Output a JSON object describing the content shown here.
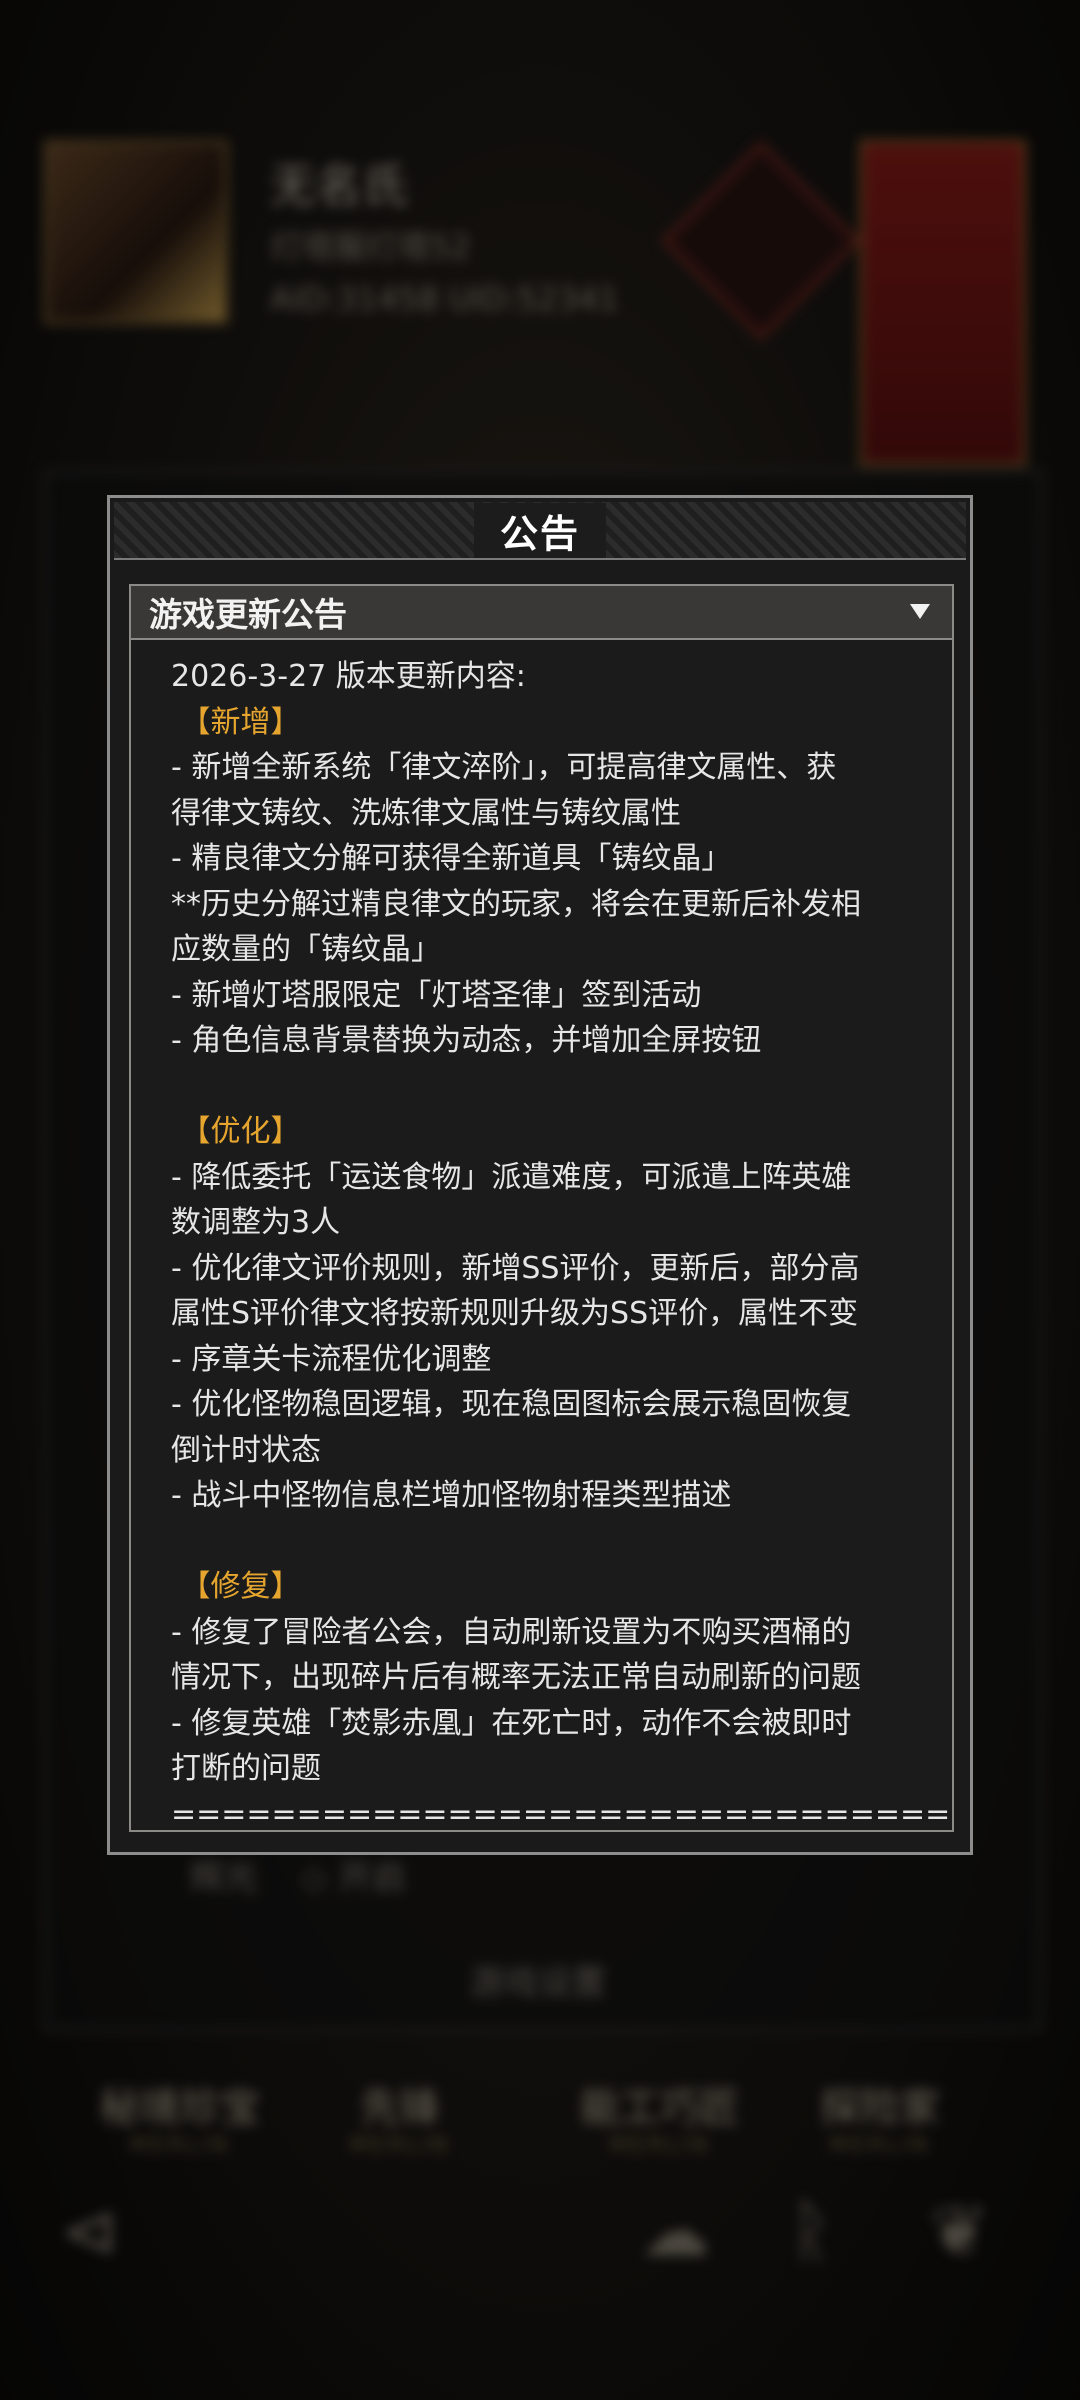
{
  "background": {
    "profile_name": "无名氏",
    "profile_sub": "灯塔服灯塔52",
    "profile_id": "AID:31458 UID:52341",
    "row_label": "辉光",
    "row_toggle": "开启",
    "settings_label": "游戏设置",
    "tabs": [
      {
        "label": "秘境珍宝",
        "sub": "MERLIN"
      },
      {
        "label": "先锋",
        "sub": "MERLIN"
      },
      {
        "label": "能工巧匠",
        "sub": "MERLIN"
      },
      {
        "label": "探险家",
        "sub": "MERLIN"
      }
    ]
  },
  "modal": {
    "title": "公告",
    "select_label": "游戏更新公告",
    "lines": [
      {
        "text": "2026-3-27 版本更新内容:",
        "type": "text"
      },
      {
        "text": " 【新增】",
        "type": "section"
      },
      {
        "text": "- 新增全新系统「律文淬阶」，可提高律文属性、获",
        "type": "text"
      },
      {
        "text": "得律文铸纹、洗炼律文属性与铸纹属性",
        "type": "text"
      },
      {
        "text": "- 精良律文分解可获得全新道具「铸纹晶」",
        "type": "text"
      },
      {
        "text": "**历史分解过精良律文的玩家，将会在更新后补发相",
        "type": "text"
      },
      {
        "text": "应数量的「铸纹晶」",
        "type": "text"
      },
      {
        "text": "- 新增灯塔服限定「灯塔圣律」签到活动",
        "type": "text"
      },
      {
        "text": "- 角色信息背景替换为动态，并增加全屏按钮",
        "type": "text"
      },
      {
        "text": "",
        "type": "blank"
      },
      {
        "text": " 【优化】",
        "type": "section"
      },
      {
        "text": "- 降低委托「运送食物」派遣难度，可派遣上阵英雄",
        "type": "text"
      },
      {
        "text": "数调整为3人",
        "type": "text"
      },
      {
        "text": "- 优化律文评价规则，新增SS评价，更新后，部分高",
        "type": "text"
      },
      {
        "text": "属性S评价律文将按新规则升级为SS评价，属性不变",
        "type": "text"
      },
      {
        "text": "- 序章关卡流程优化调整",
        "type": "text"
      },
      {
        "text": "- 优化怪物稳固逻辑，现在稳固图标会展示稳固恢复",
        "type": "text"
      },
      {
        "text": "倒计时状态",
        "type": "text"
      },
      {
        "text": "- 战斗中怪物信息栏增加怪物射程类型描述",
        "type": "text"
      },
      {
        "text": "",
        "type": "blank"
      },
      {
        "text": " 【修复】",
        "type": "section"
      },
      {
        "text": "- 修复了冒险者公会，自动刷新设置为不购买酒桶的",
        "type": "text"
      },
      {
        "text": "情况下，出现碎片后有概率无法正常自动刷新的问题",
        "type": "text"
      },
      {
        "text": "- 修复英雄「焚影赤凰」在死亡时，动作不会被即时",
        "type": "text"
      },
      {
        "text": "打断的问题",
        "type": "text"
      },
      {
        "text": "====================================",
        "type": "text"
      }
    ]
  }
}
